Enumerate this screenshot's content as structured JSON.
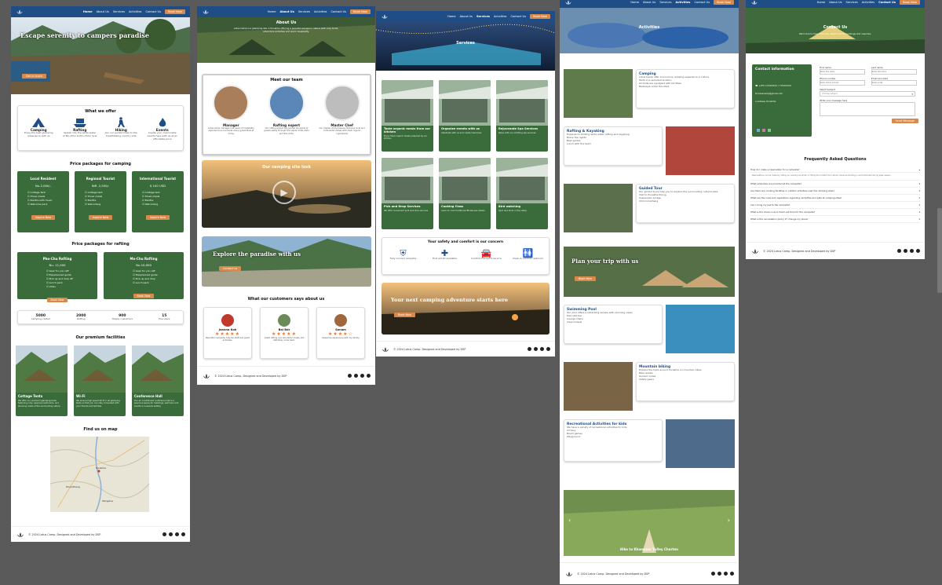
{
  "nav": {
    "items": [
      "Home",
      "About Us",
      "Services",
      "Activities",
      "Contact Us"
    ],
    "book": "Book Now"
  },
  "footer": {
    "copy": "© 2024 Lotus Camp. Designed and Developed by DSP",
    "logo_text": "Lotus Camp"
  },
  "home": {
    "hero_title": "Escape serenity to campers paradise",
    "hero_btn": "Get in touch",
    "offer_title": "What we offer",
    "offers": [
      {
        "label": "Camping",
        "desc": "Enjoy the best glamping experience with us",
        "icon": "tent-icon"
      },
      {
        "label": "Rafting",
        "desc": "Splash into the white water of Mo-Chhu & Pho-Chhu river",
        "icon": "boat-icon"
      },
      {
        "label": "Hiking",
        "desc": "Join our guided hikes to the breathtaking country side",
        "icon": "hiker-icon"
      },
      {
        "label": "Events",
        "desc": "Create your memorable events here with us at an affordable price",
        "icon": "fire-icon"
      }
    ],
    "camping_title": "Price packages for camping",
    "camping": [
      {
        "name": "Local Resident",
        "price": "Nu.2,000/-",
        "items": [
          "Cottage Tent",
          "Three meals",
          "Bonfire with music",
          "Welcome pack"
        ],
        "btn": "Inquire Now"
      },
      {
        "name": "Regional Tourist",
        "price": "INR. 2,500/-",
        "items": [
          "Cottage tent",
          "Three meals",
          "Bonfire",
          "Welcoming"
        ],
        "btn": "Inquire Now"
      },
      {
        "name": "International Tourist",
        "price": "$ 100 USD",
        "items": [
          "Cottage tent",
          "Three meals",
          "Bonfire",
          "Welcoming"
        ],
        "btn": "Inquire Now"
      }
    ],
    "rafting_title": "Price packages for rafting",
    "rafting": [
      {
        "name": "Pho-Chu Rafting",
        "price": "Nu. 11,000",
        "items": [
          "Gear for you raft",
          "Experienced guide",
          "Pick up and drop off",
          "Lunch pack",
          "Video"
        ],
        "btn": "Book Now"
      },
      {
        "name": "Mo-Chu Rafting",
        "price": "Nu.10,000",
        "items": [
          "Gear for you raft",
          "Experienced guide",
          "Pick up and drop",
          "Lunch pack"
        ],
        "btn": "Book Now"
      }
    ],
    "stats": [
      {
        "value": "5000",
        "label": "Camping visited"
      },
      {
        "value": "2000",
        "label": "Rafting"
      },
      {
        "value": "900",
        "label": "Happy customers"
      },
      {
        "value": "15",
        "label": "Five stars"
      }
    ],
    "facilities_title": "Our premium facilities",
    "facilities": [
      {
        "name": "Cottage Tents",
        "desc": "We offer our premium glamping tents featuring cozy, spacious bedrooms, and stunning views of the surrounding nature"
      },
      {
        "name": "Wi-Fi",
        "desc": "We ensure high speed Wi-Fi in all glamping tents so that you can stay connected with your friends and families"
      },
      {
        "name": "Conference Hall",
        "desc": "Our air conditioned conference hall is a spacious space for meetings, seminars and events in a serene setting"
      }
    ],
    "map_title": "Find us on map",
    "map_labels": [
      "Punakha",
      "Wangdue",
      "Khuruthang"
    ]
  },
  "about": {
    "hero_title": "About Us",
    "hero_text": "Lotus Camp is a glamping site in Punakha offering a peaceful escape in nature with cozy tents, adventure activities and warm hospitality.",
    "team_title": "Meet our team",
    "team": [
      {
        "role": "Manager",
        "desc": "Lotus Camp manager has years of hospitality experience and ensures every guest feels at home"
      },
      {
        "role": "Rafting expert",
        "desc": "Our rafting expert has guided hundreds of guests safely through the rapids of Mo-Chhu and Pho-Chhu"
      },
      {
        "role": "Master Chef",
        "desc": "Our master chef prepares delicious local and continental dishes with fresh organic ingredients"
      }
    ],
    "video_title": "Our camping site look",
    "explore_title": "Explore the paradise with us",
    "explore_btn": "Contact us",
    "reviews_title": "What our customers says about us",
    "reviews": [
      {
        "name": "Jeanna Koh",
        "stars": "★★★★★",
        "text": "Beautiful campsite, friendly staff and great activities."
      },
      {
        "name": "Bal Bdr",
        "stars": "★★★★★",
        "text": "Great rafting and wonderful meals, will definitely come back."
      },
      {
        "name": "Sonam",
        "stars": "★★★★☆",
        "text": "Awesome experience with my family."
      }
    ]
  },
  "services": {
    "hero_title": "Services",
    "grid": [
      {
        "name": "Taste organic meals from our kitchen",
        "desc": "Enjoy fresh organic meals prepared by our kitchen"
      },
      {
        "name": "Organize events with us",
        "desc": "Celebrate with us and create memories"
      },
      {
        "name": "Rejuvenate Spa Services",
        "desc": "Relax with our soothing spa services"
      },
      {
        "name": "Pick and Drop Services",
        "desc": "We offer convenient pick and drop services"
      },
      {
        "name": "Cooking Class",
        "desc": "Learn to cook traditional Bhutanese dishes"
      },
      {
        "name": "Bird watching",
        "desc": "Spot rare birds in the valley"
      }
    ],
    "safety_title": "Your safety  and  comfort is our concern",
    "safety": [
      {
        "label": "Fully insured campsite",
        "icon": "shield-icon"
      },
      {
        "label": "First aid kit available",
        "icon": "first-aid-icon"
      },
      {
        "label": "Comfort transport service",
        "icon": "car-icon"
      },
      {
        "label": "Clean & comfort restroom",
        "icon": "restroom-icon"
      }
    ],
    "next_title": "Your next camping adventure starts here",
    "next_btn": "Book Now"
  },
  "activities": {
    "hero_title": "Activities",
    "items": [
      {
        "name": "Camping",
        "desc": "Lotus Camp offer a luxurious camping experience in nature",
        "items": [
          "Tents in a secluded location",
          "All tents are equipped with facilities",
          "Barbeque under the stars"
        ]
      },
      {
        "name": "Rafting & Kayaking",
        "desc": "Experience thrilling white water rafting and kayaking",
        "items": [
          "Brave the rapids",
          "Best guides",
          "Lunch with the team"
        ]
      },
      {
        "name": "Guided Tour",
        "desc": "Our guided tours help you to explore the surrounding cultural sites",
        "items": [
          "Visit to Punakha Dzong",
          "Suspension bridge",
          "Chimi Lhakhang"
        ]
      },
      {
        "name": "Swimming Pool",
        "desc": "Our pool offers a refreshing escape with stunning views",
        "items": [
          "Pool side bar",
          "Lounge chairs",
          "Clean towels"
        ]
      },
      {
        "name": "Mountain biking",
        "desc": "Explore the trails around Punakha on mountain bikes",
        "items": [
          "Bike rentals",
          "Guided routes",
          "Safety gears"
        ]
      },
      {
        "name": "Recreational Activities for kids",
        "desc": "We have a variety of recreational activities for kids",
        "items": [
          "Archery",
          "Board games",
          "Playground"
        ]
      }
    ],
    "plan_title": "Plan your trip with us",
    "plan_btn": "Book Now",
    "slider_caption": "Hike to Khamsum Yulley Chorten"
  },
  "contact": {
    "hero_title": "Contact Us",
    "hero_text": "We'd love to hear from you. Reach out for bookings and inquiries.",
    "info_title": "Contact information",
    "info": [
      "+975 17XXXXXX / 77XXXXXX",
      "lotuscamp@gmail.com",
      "Lobesa, Punakha"
    ],
    "fields": [
      {
        "label": "First name",
        "placeholder": "Enter first name"
      },
      {
        "label": "Last name",
        "placeholder": "Enter last name"
      },
      {
        "label": "Phone number",
        "placeholder": "Enter phone number"
      },
      {
        "label": "Email provided",
        "placeholder": "Enter email"
      }
    ],
    "select_label": "Select Subject",
    "select_value": "Choose subject",
    "msg_label": "Write your message here",
    "send": "Send Message",
    "faq_title": "Frequently Asked Questions",
    "faqs": [
      "How do I make a reservation for a campsite?",
      "What amenities are provided at the campsite?",
      "Are there any cooking facilities or outdoor activities near the camping sites?",
      "What are the rules and regulations regarding campfires and pets at camping sites?",
      "Can I bring my pet to the campsite?",
      "What is the check-in and check-out time for the campsite?",
      "What is the cancellation policy if I change my plans?"
    ],
    "faq_answer": "Reservations can be made by calling us, sending an email, or filling the contact form above. Advance booking is recommended during peak season."
  }
}
